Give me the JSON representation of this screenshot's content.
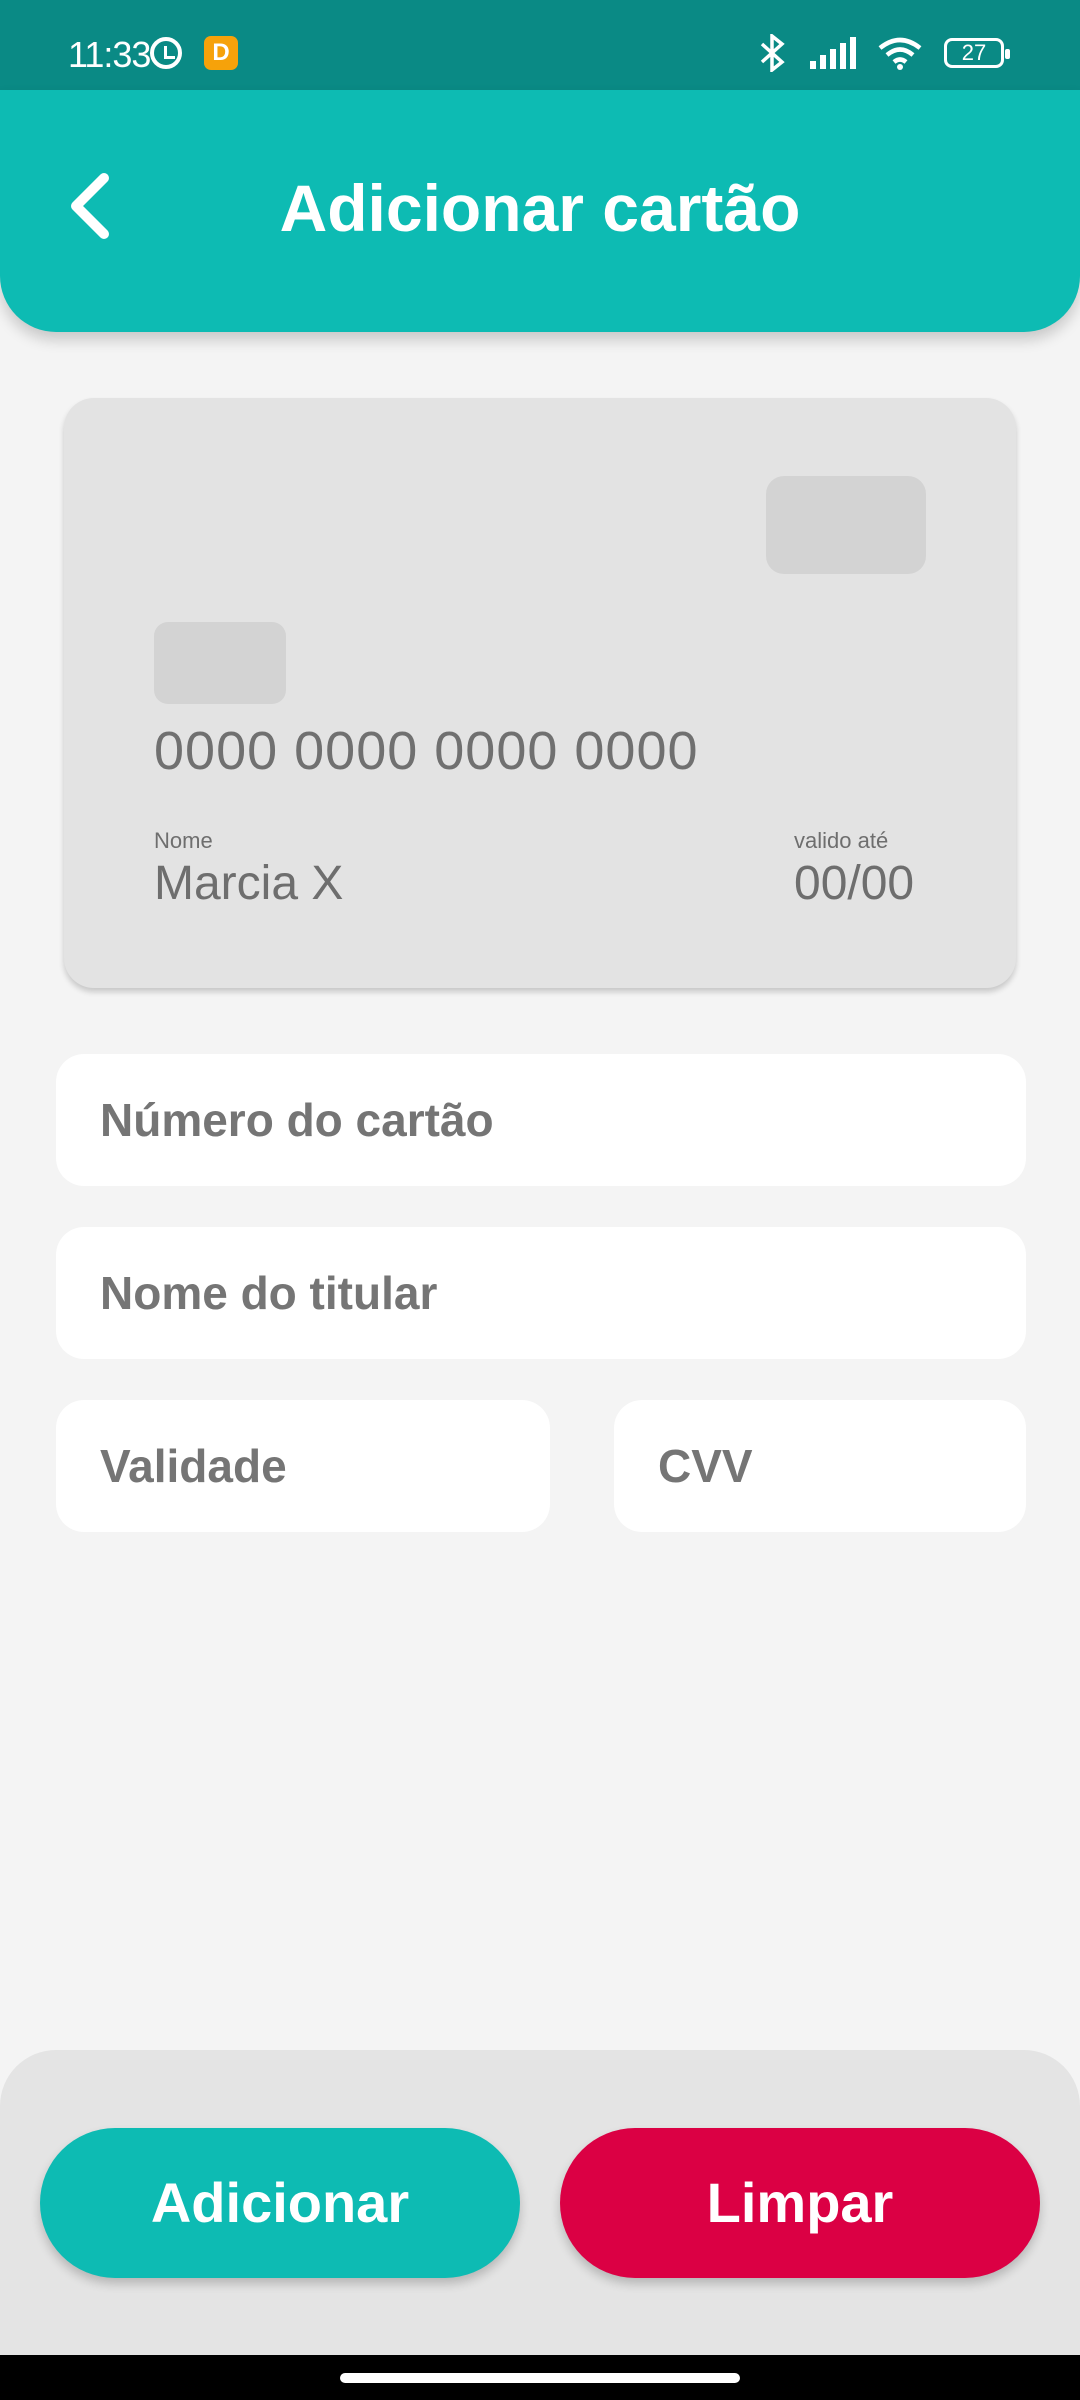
{
  "status_bar": {
    "time": "11:33",
    "app_badge": "D",
    "battery": "27",
    "icons": [
      "alarm-icon",
      "app-notification-icon",
      "bluetooth-icon",
      "signal-icon",
      "wifi-icon",
      "battery-icon"
    ]
  },
  "header": {
    "title": "Adicionar cartão",
    "back_icon": "chevron-left-icon"
  },
  "card_preview": {
    "number": "0000 0000 0000 0000",
    "name_label": "Nome",
    "name_value": "Marcia X",
    "expiry_label": "valido até",
    "expiry_value": "00/00"
  },
  "form": {
    "card_number": {
      "placeholder": "Número do cartão",
      "value": ""
    },
    "holder_name": {
      "placeholder": "Nome do titular",
      "value": ""
    },
    "validity": {
      "placeholder": "Validade",
      "value": ""
    },
    "cvv": {
      "placeholder": "CVV",
      "value": ""
    }
  },
  "actions": {
    "add_label": "Adicionar",
    "clear_label": "Limpar"
  },
  "colors": {
    "primary": "#0dbbb3",
    "status_bar": "#0a8a85",
    "danger": "#db0044",
    "background": "#f4f4f4"
  }
}
